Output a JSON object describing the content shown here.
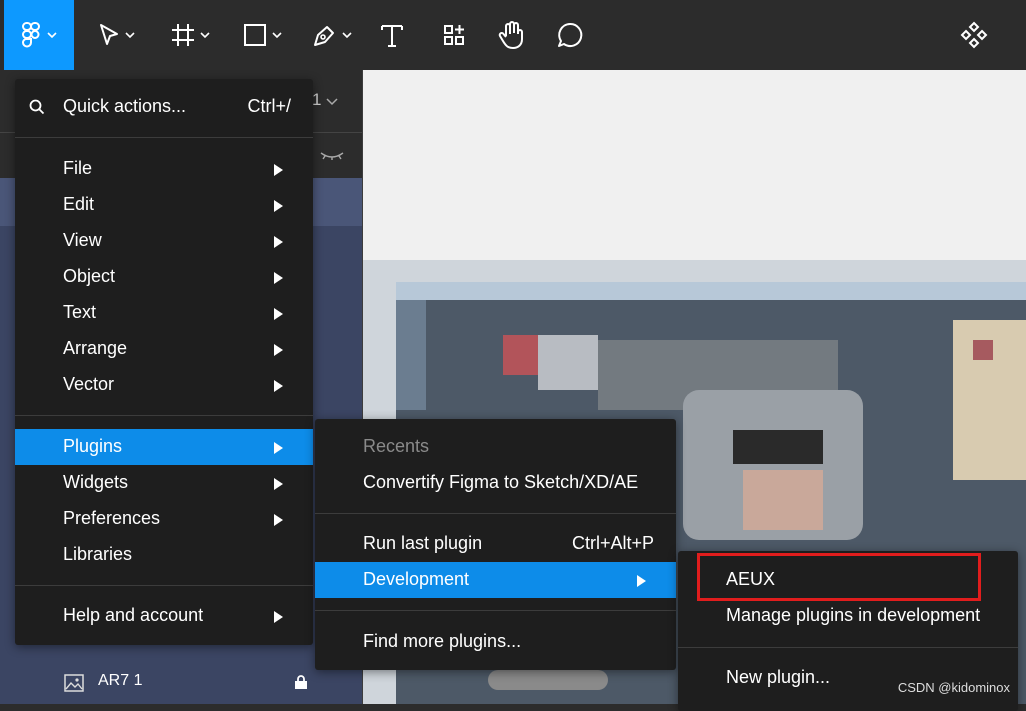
{
  "toolbar": {
    "tools": [
      {
        "name": "main-menu",
        "icon": "figma-logo-icon"
      },
      {
        "name": "move",
        "icon": "move-cursor-icon"
      },
      {
        "name": "frame",
        "icon": "frame-hash-icon"
      },
      {
        "name": "shape",
        "icon": "rectangle-icon"
      },
      {
        "name": "pen",
        "icon": "pen-icon"
      },
      {
        "name": "text",
        "icon": "text-icon"
      },
      {
        "name": "resources",
        "icon": "resources-icon"
      },
      {
        "name": "hand",
        "icon": "hand-icon"
      },
      {
        "name": "comment",
        "icon": "comment-icon"
      },
      {
        "name": "components",
        "icon": "components-icon"
      }
    ],
    "accent": "#0d99ff"
  },
  "left_panel": {
    "page_partial": "1",
    "layer": {
      "name": "AR7 1",
      "icon": "image-icon",
      "locked": true
    }
  },
  "main_menu": {
    "quick_actions": {
      "label": "Quick actions...",
      "shortcut": "Ctrl+/"
    },
    "items_group1": [
      {
        "label": "File",
        "submenu": true
      },
      {
        "label": "Edit",
        "submenu": true
      },
      {
        "label": "View",
        "submenu": true
      },
      {
        "label": "Object",
        "submenu": true
      },
      {
        "label": "Text",
        "submenu": true
      },
      {
        "label": "Arrange",
        "submenu": true
      },
      {
        "label": "Vector",
        "submenu": true
      }
    ],
    "items_group2": [
      {
        "label": "Plugins",
        "submenu": true,
        "active": true
      },
      {
        "label": "Widgets",
        "submenu": true
      },
      {
        "label": "Preferences",
        "submenu": true
      },
      {
        "label": "Libraries",
        "submenu": false
      }
    ],
    "help": {
      "label": "Help and account",
      "submenu": true
    }
  },
  "plugins_menu": {
    "recents_header": "Recents",
    "recent_plugin": "Convertify Figma to Sketch/XD/AE",
    "run_last": {
      "label": "Run last plugin",
      "shortcut": "Ctrl+Alt+P"
    },
    "development": {
      "label": "Development",
      "submenu": true,
      "active": true
    },
    "find_more": "Find more plugins..."
  },
  "development_menu": {
    "items": [
      "AEUX",
      "Manage plugins in development"
    ],
    "new_plugin": "New plugin...",
    "highlight_color": "#e11d1d"
  },
  "watermark": "CSDN @kidominox"
}
